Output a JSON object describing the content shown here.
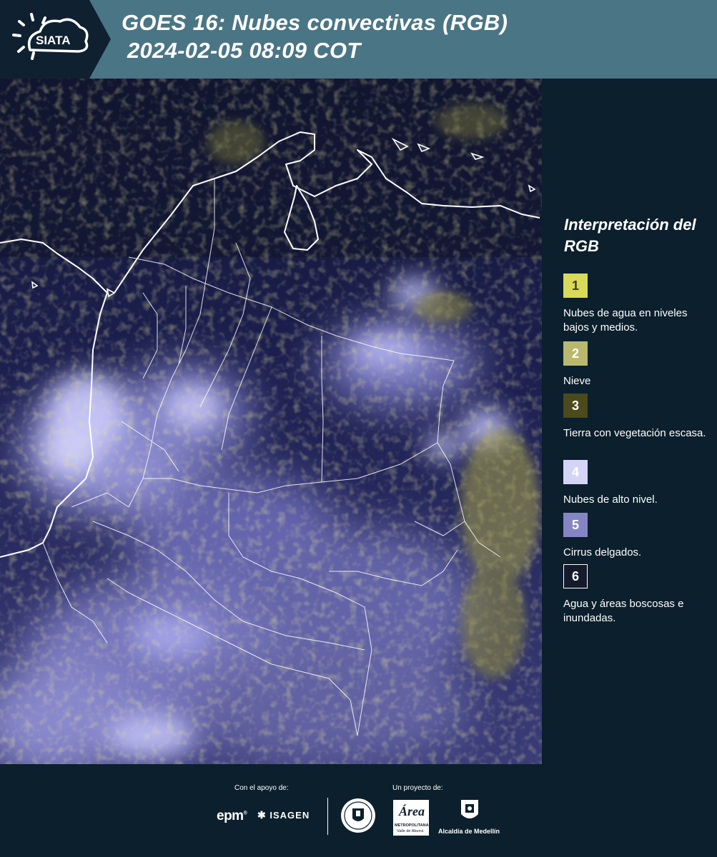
{
  "header": {
    "logo_text": "SIATA",
    "title_line1": "GOES 16: Nubes convectivas (RGB)",
    "title_line2": "2024-02-05 08:09 COT"
  },
  "map": {
    "description_icon": "satellite-map-image"
  },
  "legend": {
    "title": "Interpretación del RGB",
    "items": [
      {
        "number": "1",
        "label": "Nubes de agua en niveles bajos y medios.",
        "color": "#d9d95a",
        "text_color": "#3a3a10"
      },
      {
        "number": "2",
        "label": "Nieve",
        "color": "#b9b86e",
        "text_color": "#ffffff"
      },
      {
        "number": "3",
        "label": "Tierra con vegetación escasa.",
        "color": "#4a4a1c",
        "text_color": "#ffffff"
      },
      {
        "number": "4",
        "label": "Nubes de alto nivel.",
        "color": "#d4d4f7",
        "text_color": "#ffffff"
      },
      {
        "number": "5",
        "label": "Cirrus delgados.",
        "color": "#8585c6",
        "text_color": "#ffffff"
      },
      {
        "number": "6",
        "label": "Agua y áreas boscosas e inundadas.",
        "color": "#151a2c",
        "text_color": "#ffffff",
        "border": "#ffffff"
      }
    ]
  },
  "footer": {
    "support_caption": "Con el apoyo de:",
    "project_caption": "Un proyecto de:",
    "sponsor_epm": "epm",
    "sponsor_isagen": "ISAGEN",
    "area_logo_text": "Área",
    "area_sub1": "METROPOLITANA",
    "area_sub2": "Valle de Aburrá",
    "alcaldia": "Alcaldía de Medellín"
  }
}
